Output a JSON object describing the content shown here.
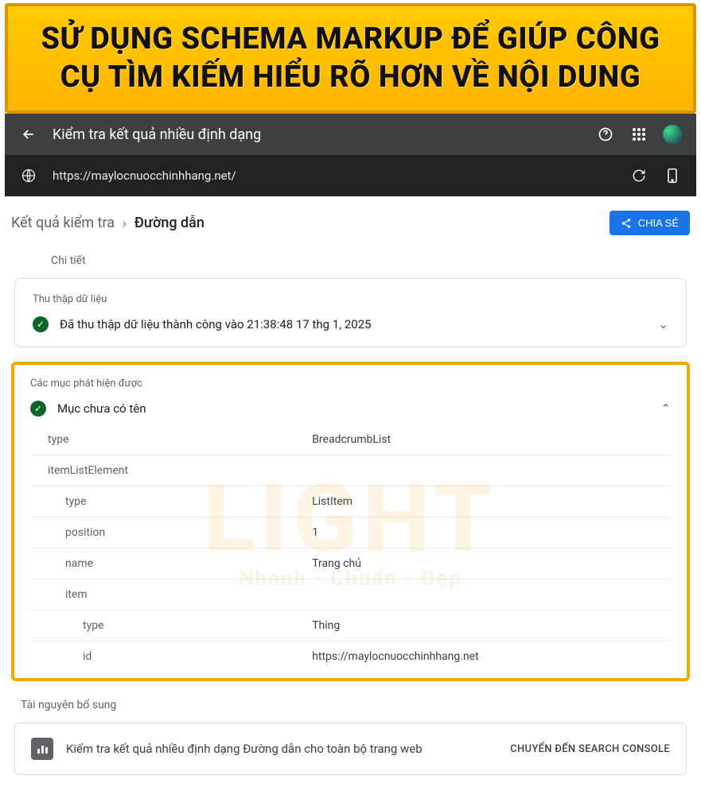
{
  "banner": {
    "headline": "SỬ DỤNG SCHEMA MARKUP ĐỂ GIÚP CÔNG CỤ TÌM KIẾM HIỂU RÕ HƠN VỀ NỘI DUNG"
  },
  "appbar": {
    "title": "Kiểm tra kết quả nhiều định dạng"
  },
  "urlbar": {
    "url": "https://maylocnuocchinhhang.net/"
  },
  "breadcrumb": {
    "a": "Kết quả kiểm tra",
    "b": "Đường dẫn"
  },
  "share": {
    "label": "CHIA SẺ"
  },
  "details": {
    "label": "Chi tiết"
  },
  "crawl": {
    "section_label": "Thu thập dữ liệu",
    "status_text": "Đã thu thập dữ liệu thành công vào 21:38:48 17 thg 1, 2025"
  },
  "detected": {
    "section_label": "Các mục phát hiện được",
    "unnamed_label": "Mục chưa có tên",
    "rows": {
      "r0k": "type",
      "r0v": "BreadcrumbList",
      "r1k": "itemListElement",
      "r1v": "",
      "r2k": "type",
      "r2v": "ListItem",
      "r3k": "position",
      "r3v": "1",
      "r4k": "name",
      "r4v": "Trang chủ",
      "r5k": "item",
      "r5v": "",
      "r6k": "type",
      "r6v": "Thing",
      "r7k": "id",
      "r7v": "https://maylocnuocchinhhang.net"
    }
  },
  "resources": {
    "section_label": "Tài nguyên bổ sung",
    "sc_text": "Kiểm tra kết quả nhiều định dạng Đường dẫn cho toàn bộ trang web",
    "sc_cta": "CHUYỂN ĐẾN SEARCH CONSOLE"
  },
  "watermark": {
    "big": "LIGHT",
    "sub": "Nhanh - Chuẩn - Đẹp"
  }
}
